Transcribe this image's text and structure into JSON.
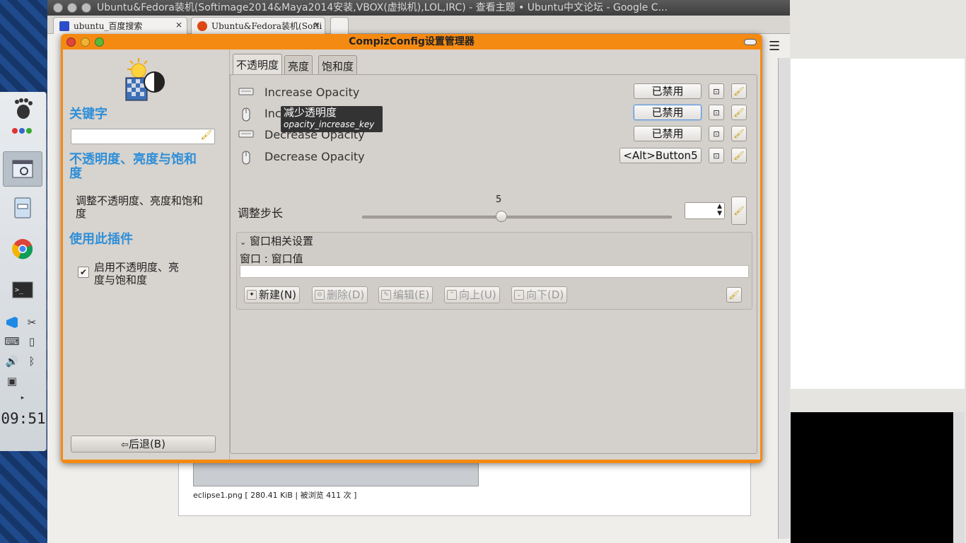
{
  "browser": {
    "title": "Ubuntu&Fedora装机(Softimage2014&Maya2014安装,VBOX(虚拟机),LOL,IRC) - 查看主题 • Ubuntu中文论坛 - Google C...",
    "tabs": [
      {
        "label": "ubuntu_百度搜索",
        "close": "×"
      },
      {
        "label": "Ubuntu&Fedora装机(Softi",
        "close": "×"
      }
    ],
    "caption": "eclipse1.png [ 280.41 KiB | 被浏览 411 次 ]"
  },
  "dock": {
    "clock": "09:51"
  },
  "dialog": {
    "title": "CompizConfig设置管理器",
    "sidebar": {
      "keyword_heading": "关键字",
      "search_placeholder": "",
      "plugin_name": "不透明度、亮度与饱和度",
      "plugin_desc": "调整不透明度、亮度和饱和度",
      "use_heading": "使用此插件",
      "enable_label": "启用不透明度、亮度与饱和度",
      "enable_checked": true,
      "back_button": "后退(B)"
    },
    "tabs": [
      {
        "label": "不透明度",
        "active": true
      },
      {
        "label": "亮度",
        "active": false
      },
      {
        "label": "饱和度",
        "active": false
      }
    ],
    "bindings": [
      {
        "label": "Increase Opacity",
        "icon": "keyboard-icon",
        "value": "已禁用"
      },
      {
        "label": "Increase Opacity",
        "icon": "mouse-icon",
        "value": "已禁用"
      },
      {
        "label": "Decrease Opacity",
        "icon": "keyboard-icon",
        "value": "已禁用"
      },
      {
        "label": "Decrease Opacity",
        "icon": "mouse-icon",
        "value": "<Alt>Button5"
      }
    ],
    "tooltip": {
      "title": "减少透明度",
      "key": "opacity_increase_key"
    },
    "step": {
      "label": "调整步长",
      "value": "5",
      "fraction": 0.45
    },
    "window_settings": {
      "heading": "窗口相关设置",
      "columns": "窗口 : 窗口值",
      "buttons": {
        "new": "新建(N)",
        "delete": "删除(D)",
        "edit": "编辑(E)",
        "up": "向上(U)",
        "down": "向下(D)"
      }
    }
  },
  "colors": {
    "accent_orange": "#f58a12",
    "heading_blue": "#2f8fd8"
  }
}
